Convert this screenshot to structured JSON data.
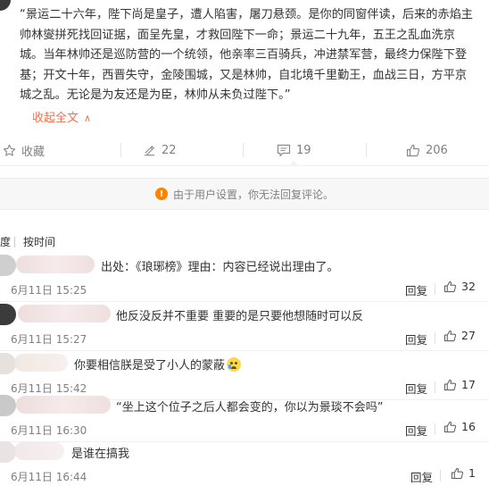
{
  "post": {
    "text": "“景运二十六年，陛下尚是皇子，遭人陷害，屠刀悬颈。是你的同窗伴读，后来的赤焰主帅林燮拼死找回证据，面呈先皇，才救回陛下一命；景运二十九年，五王之乱血洗京城。当年林帅还是巡防营的一个统领，他亲率三百骑兵，冲进禁军营，最终力保陛下登基；开文十年，西晋失守，金陵围城，又是林帅，自北境千里勤王，血战三日，方平京城之乱。无论是为友还是为臣，林帅从未负过陛下。”",
    "collapse_label": "收起全文"
  },
  "actions": {
    "favorite": "收藏",
    "repost": "22",
    "comment": "19",
    "like": "206"
  },
  "notice": "由于用户设置，你无法回复评论。",
  "sort": {
    "hot_partial": "度",
    "by_time": "按时间"
  },
  "comments": [
    {
      "text": "出处：《琅琊榜》理由：内容已经说出理由了。",
      "time": "6月11日 15:25",
      "reply": "回复",
      "likes": "32"
    },
    {
      "text": "他反没反并不重要 重要的是只要他想随时可以反",
      "time": "6月11日 15:27",
      "reply": "回复",
      "likes": "27"
    },
    {
      "text": "你要相信朕是受了小人的蒙蔽",
      "time": "6月11日 15:42",
      "reply": "回复",
      "likes": "17"
    },
    {
      "text": "“坐上这个位子之后人都会变的，你以为景琰不会吗”",
      "time": "6月11日 16:30",
      "reply": "回复",
      "likes": "16"
    },
    {
      "text": "是谁在搞我",
      "time": "6月11日 16:44",
      "reply": "回复",
      "likes": "1"
    }
  ],
  "colors": {
    "accent": "#eb7350",
    "warning": "#ff8200",
    "muted": "#808080"
  }
}
